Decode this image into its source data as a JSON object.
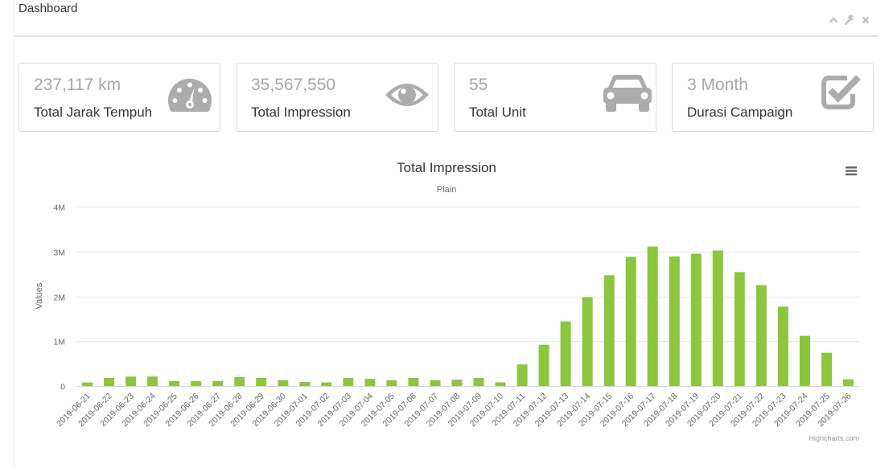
{
  "header": {
    "title": "Dashboard",
    "tools": [
      "chevron-up-icon",
      "wrench-icon",
      "close-icon"
    ]
  },
  "stats": [
    {
      "value": "237,117 km",
      "label": "Total Jarak Tempuh",
      "icon": "speedometer-icon"
    },
    {
      "value": "35,567,550",
      "label": "Total Impression",
      "icon": "eye-icon"
    },
    {
      "value": "55",
      "label": "Total Unit",
      "icon": "car-icon"
    },
    {
      "value": "3 Month",
      "label": "Durasi Campaign",
      "icon": "check-square-icon"
    }
  ],
  "chart": {
    "menu_icon": "hamburger-menu-icon",
    "credits": "Highcharts.com"
  },
  "colors": {
    "bar": "#8cc63f",
    "icon": "#acacac",
    "grid": "#e6e6e6"
  },
  "chart_data": {
    "type": "bar",
    "title": "Total Impression",
    "subtitle": "Plain",
    "ylabel": "Values",
    "ylim": [
      0,
      4000000
    ],
    "yticks": [
      0,
      1000000,
      2000000,
      3000000,
      4000000
    ],
    "ytick_labels": [
      "0",
      "1M",
      "2M",
      "3M",
      "4M"
    ],
    "grid": true,
    "categories": [
      "2019-06-21",
      "2019-06-22",
      "2019-06-23",
      "2019-06-24",
      "2019-06-25",
      "2019-06-26",
      "2019-06-27",
      "2019-06-28",
      "2019-06-29",
      "2019-06-30",
      "2019-07-01",
      "2019-07-02",
      "2019-07-03",
      "2019-07-04",
      "2019-07-05",
      "2019-07-06",
      "2019-07-07",
      "2019-07-08",
      "2019-07-09",
      "2019-07-10",
      "2019-07-11",
      "2019-07-12",
      "2019-07-13",
      "2019-07-14",
      "2019-07-15",
      "2019-07-16",
      "2019-07-17",
      "2019-07-18",
      "2019-07-19",
      "2019-07-20",
      "2019-07-21",
      "2019-07-22",
      "2019-07-23",
      "2019-07-24",
      "2019-07-25",
      "2019-07-26"
    ],
    "values": [
      80000,
      180000,
      210000,
      210000,
      110000,
      110000,
      110000,
      200000,
      180000,
      130000,
      90000,
      80000,
      180000,
      160000,
      130000,
      180000,
      130000,
      140000,
      180000,
      80000,
      480000,
      920000,
      1440000,
      1980000,
      2470000,
      2880000,
      3110000,
      2890000,
      2950000,
      3020000,
      2540000,
      2250000,
      1770000,
      1120000,
      740000,
      150000
    ]
  }
}
